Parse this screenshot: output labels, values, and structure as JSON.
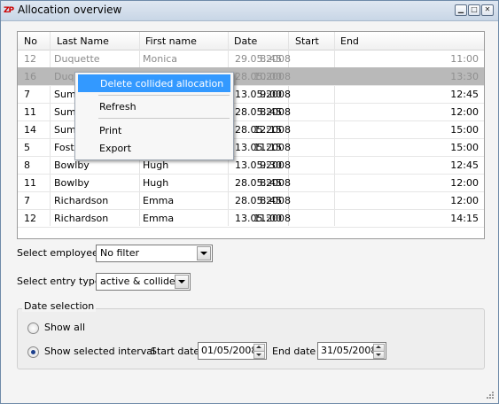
{
  "window": {
    "title": "Allocation overview",
    "app_icon": "ZP"
  },
  "table": {
    "columns": [
      "No",
      "Last Name",
      "First name",
      "Date",
      "Start",
      "End"
    ],
    "rows": [
      {
        "no": "12",
        "last": "Duquette",
        "first": "Monica",
        "date": "29.05.2008",
        "start": "8:45",
        "end": "11:00"
      },
      {
        "no": "16",
        "last": "Duquette",
        "first": "Monica",
        "date": "28.05.2008",
        "start": "10:00",
        "end": "13:30"
      },
      {
        "no": "7",
        "last": "Summ",
        "first": "",
        "date": "13.05.2008",
        "start": "9:00",
        "end": "12:45"
      },
      {
        "no": "11",
        "last": "Summ",
        "first": "",
        "date": "28.05.2008",
        "start": "8:45",
        "end": "12:00"
      },
      {
        "no": "14",
        "last": "Summ",
        "first": "",
        "date": "28.05.2008",
        "start": "12:15",
        "end": "15:00"
      },
      {
        "no": "5",
        "last": "Foste",
        "first": "",
        "date": "13.05.2008",
        "start": "11:15",
        "end": "15:00"
      },
      {
        "no": "8",
        "last": "Bowlby",
        "first": "Hugh",
        "date": "13.05.2008",
        "start": "9:30",
        "end": "12:45"
      },
      {
        "no": "11",
        "last": "Bowlby",
        "first": "Hugh",
        "date": "28.05.2008",
        "start": "8:45",
        "end": "12:00"
      },
      {
        "no": "7",
        "last": "Richardson",
        "first": "Emma",
        "date": "28.05.2008",
        "start": "8:45",
        "end": "12:00"
      },
      {
        "no": "12",
        "last": "Richardson",
        "first": "Emma",
        "date": "13.05.2008",
        "start": "11:00",
        "end": "14:15"
      }
    ]
  },
  "context_menu": {
    "items": [
      "Delete collided allocation",
      "Refresh",
      "Print",
      "Export"
    ]
  },
  "filters": {
    "employee_label": "Select employee:",
    "employee_value": "No filter",
    "entry_type_label": "Select entry type:",
    "entry_type_value": "active & collided"
  },
  "date_selection": {
    "title": "Date selection",
    "show_all": "Show all",
    "show_interval": "Show selected interval",
    "selected": "show_interval",
    "start_label": "Start date",
    "start_value": "01/05/2008",
    "end_label": "End date",
    "end_value": "31/05/2008"
  },
  "colors": {
    "selection": "#3399ff",
    "selected_row": "#b9b9b9"
  }
}
